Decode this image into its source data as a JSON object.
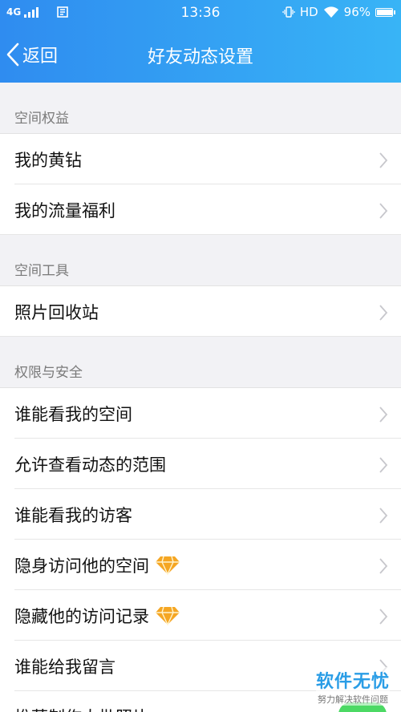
{
  "status_bar": {
    "network": "4G",
    "time": "13:36",
    "hd": "HD",
    "battery_percent": "96%",
    "battery_level": 0.96
  },
  "nav": {
    "back_label": "返回",
    "title": "好友动态设置"
  },
  "sections": [
    {
      "header": "空间权益",
      "items": [
        {
          "label": "我的黄钻"
        },
        {
          "label": "我的流量福利"
        }
      ]
    },
    {
      "header": "空间工具",
      "items": [
        {
          "label": "照片回收站"
        }
      ]
    },
    {
      "header": "权限与安全",
      "items": [
        {
          "label": "谁能看我的空间"
        },
        {
          "label": "允许查看动态的范围"
        },
        {
          "label": "谁能看我的访客"
        },
        {
          "label": "隐身访问他的空间",
          "badge": "diamond-icon"
        },
        {
          "label": "隐藏他的访问记录",
          "badge": "diamond-icon"
        },
        {
          "label": "谁能给我留言"
        },
        {
          "label": "推荐制作大批照片"
        }
      ]
    }
  ],
  "watermark": {
    "main": "软件无忧",
    "sub": "努力解决软件问题"
  },
  "colors": {
    "header_gradient_start": "#2f8cf0",
    "header_gradient_end": "#38b4f6",
    "diamond": "#f5a623",
    "watermark": "#2a9de6",
    "toggle_on": "#4cd964"
  }
}
